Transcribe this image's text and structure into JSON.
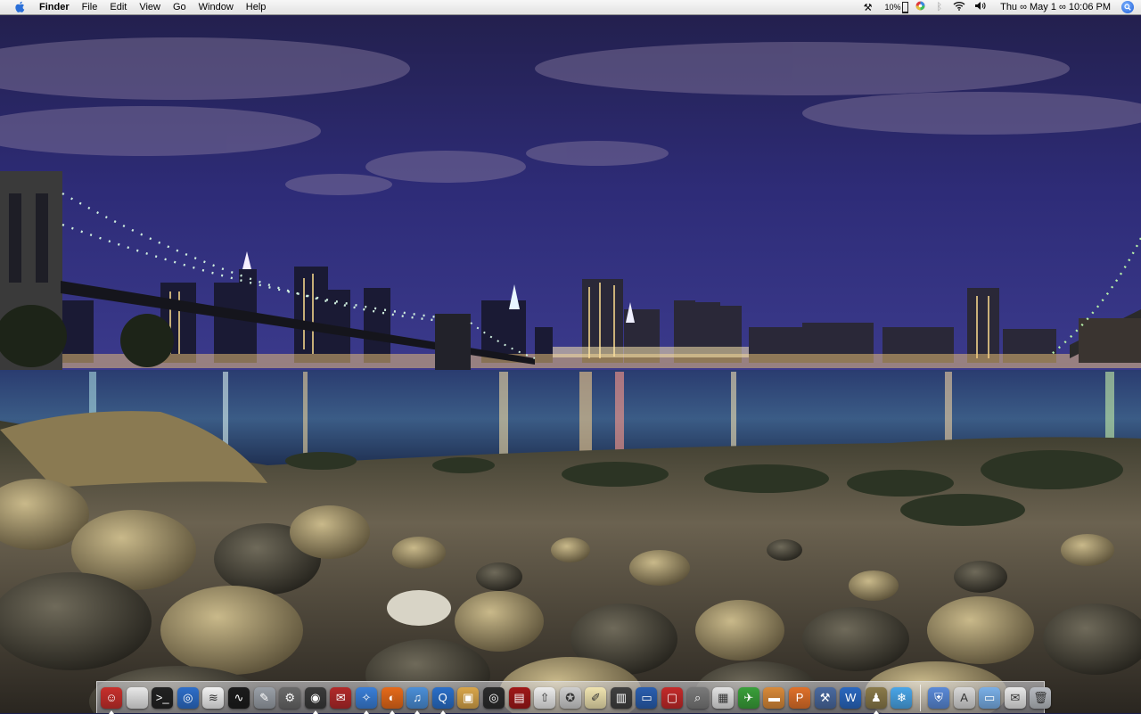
{
  "menubar": {
    "apple_icon": "apple-logo-icon",
    "app_name": "Finder",
    "menus": [
      "File",
      "Edit",
      "View",
      "Go",
      "Window",
      "Help"
    ],
    "status": {
      "tools_icon": "tools-icon",
      "cpu_percent": "10%",
      "color_icon": "color-wheel-icon",
      "bluetooth_icon": "bluetooth-icon",
      "wifi_icon": "wifi-icon",
      "volume_icon": "volume-icon",
      "clock": "Thu ∞ May 1 ∞ 10:06 PM",
      "spotlight_icon": "spotlight-icon"
    }
  },
  "wallpaper": {
    "subject": "night-city-skyline-wallpaper"
  },
  "dock": {
    "apps": [
      {
        "name": "finder-icon",
        "color": "#c8302c",
        "glyph": "☺",
        "running": true
      },
      {
        "name": "system-prefs-icon",
        "color": "#e8e8e8",
        "glyph": "",
        "running": false
      },
      {
        "name": "terminal-icon",
        "color": "#222222",
        "glyph": ">_",
        "running": false
      },
      {
        "name": "network-icon",
        "color": "#2d6ec9",
        "glyph": "◎",
        "running": false
      },
      {
        "name": "airport-icon",
        "color": "#f2f2f2",
        "glyph": "≋",
        "running": false
      },
      {
        "name": "activity-monitor-icon",
        "color": "#1c1c1c",
        "glyph": "∿",
        "running": false
      },
      {
        "name": "utility-icon",
        "color": "#9aa0a8",
        "glyph": "✎",
        "running": false
      },
      {
        "name": "script-icon",
        "color": "#6a6a6a",
        "glyph": "⚙",
        "running": false
      },
      {
        "name": "dashboard-icon",
        "color": "#3a3a3a",
        "glyph": "◉",
        "running": true
      },
      {
        "name": "stamp-icon",
        "color": "#b22a2a",
        "glyph": "✉",
        "running": false
      },
      {
        "name": "safari-icon",
        "color": "#3a7fd8",
        "glyph": "✧",
        "running": true
      },
      {
        "name": "firefox-icon",
        "color": "#e66a1a",
        "glyph": "◐",
        "running": true
      },
      {
        "name": "itunes-icon",
        "color": "#4b8fd8",
        "glyph": "♫",
        "running": true
      },
      {
        "name": "quicktime-icon",
        "color": "#2a6fc9",
        "glyph": "Q",
        "running": true
      },
      {
        "name": "iphoto-icon",
        "color": "#d9a64a",
        "glyph": "▣",
        "running": false
      },
      {
        "name": "aperture-icon",
        "color": "#2c2c2c",
        "glyph": "◎",
        "running": false
      },
      {
        "name": "photo-booth-icon",
        "color": "#a01818",
        "glyph": "▤",
        "running": false
      },
      {
        "name": "flickr-uploader-icon",
        "color": "#ececec",
        "glyph": "⇧",
        "running": false
      },
      {
        "name": "red-app-icon",
        "color": "#cfcfcf",
        "glyph": "✪",
        "running": false
      },
      {
        "name": "textedit-icon",
        "color": "#f0e4b0",
        "glyph": "✐",
        "running": false
      },
      {
        "name": "notebook-icon",
        "color": "#404040",
        "glyph": "▥",
        "running": false
      },
      {
        "name": "screen-sharing-icon",
        "color": "#2a5fb0",
        "glyph": "▭",
        "running": false
      },
      {
        "name": "parallels-icon",
        "color": "#c42a2a",
        "glyph": "▢",
        "running": false
      },
      {
        "name": "magnifier-icon",
        "color": "#7a7a7a",
        "glyph": "⌕",
        "running": false
      },
      {
        "name": "charts-icon",
        "color": "#e2e2e2",
        "glyph": "▦",
        "running": false
      },
      {
        "name": "ftp-icon",
        "color": "#3aa03a",
        "glyph": "✈",
        "running": false
      },
      {
        "name": "presentation-icon",
        "color": "#d88a3a",
        "glyph": "▬",
        "running": false
      },
      {
        "name": "pages-icon",
        "color": "#e0712a",
        "glyph": "P",
        "running": false
      },
      {
        "name": "xcode-icon",
        "color": "#4a6aa0",
        "glyph": "⚒",
        "running": false
      },
      {
        "name": "word-icon",
        "color": "#2a68c0",
        "glyph": "W",
        "running": false
      },
      {
        "name": "automator-icon",
        "color": "#8a7a4a",
        "glyph": "♟",
        "running": true
      },
      {
        "name": "snowflake-icon",
        "color": "#4aa6e8",
        "glyph": "❄",
        "running": false
      }
    ],
    "stacks": [
      {
        "name": "security-shield-icon",
        "color": "#5a8ad8",
        "glyph": "⛨"
      },
      {
        "name": "applications-stack-icon",
        "color": "#d8d8d8",
        "glyph": "A"
      },
      {
        "name": "documents-stack-icon",
        "color": "#7ab0e8",
        "glyph": "▭"
      },
      {
        "name": "mail-stack-icon",
        "color": "#e8e8e8",
        "glyph": "✉"
      },
      {
        "name": "trash-icon",
        "color": "#b8bcc2",
        "glyph": "🗑"
      }
    ]
  }
}
